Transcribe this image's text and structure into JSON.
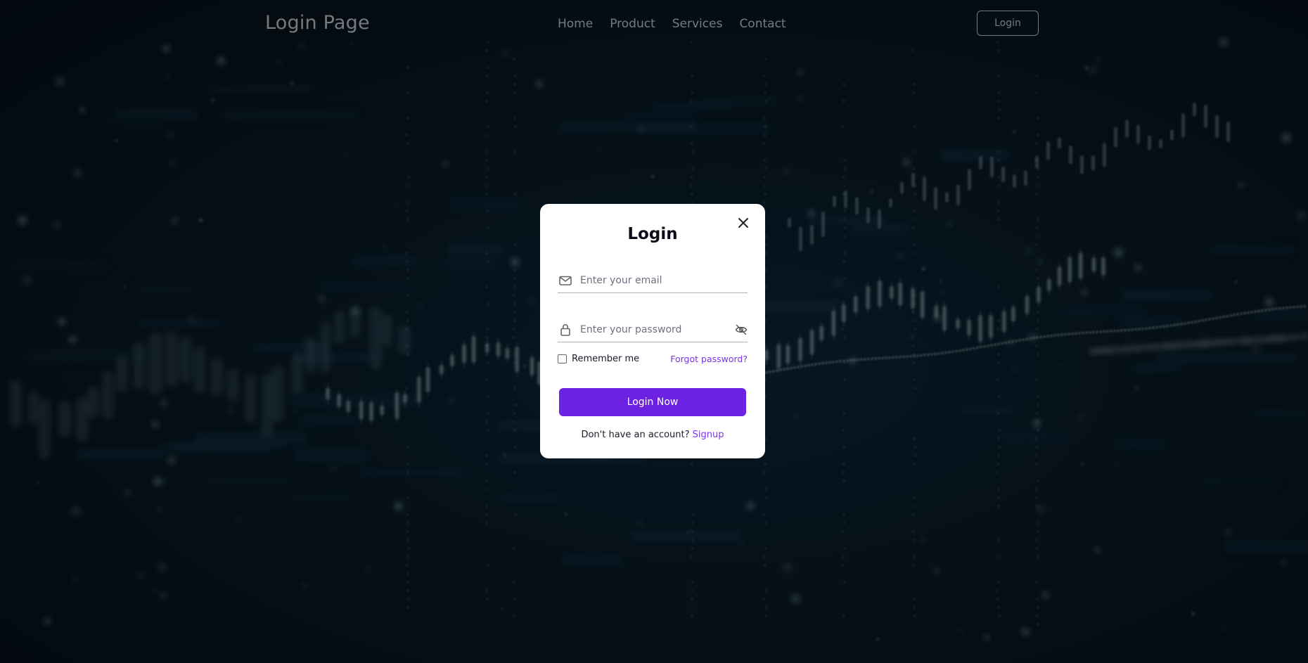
{
  "header": {
    "logo": "Login Page",
    "nav": [
      "Home",
      "Product",
      "Services",
      "Contact"
    ],
    "login_button": "Login"
  },
  "modal": {
    "title": "Login",
    "email": {
      "placeholder": "Enter your email",
      "icon": "envelope-icon"
    },
    "password": {
      "placeholder": "Enter your password",
      "icon": "lock-icon",
      "toggle_icon": "eye-off-icon"
    },
    "remember_label": "Remember me",
    "forgot_label": "Forgot password?",
    "submit_label": "Login Now",
    "signup_prompt": "Don't have an account?",
    "signup_link": "Signup"
  },
  "colors": {
    "accent": "#6c22e0",
    "link": "#7a33e6",
    "background": "#07141d",
    "modal_bg": "#ffffff"
  }
}
